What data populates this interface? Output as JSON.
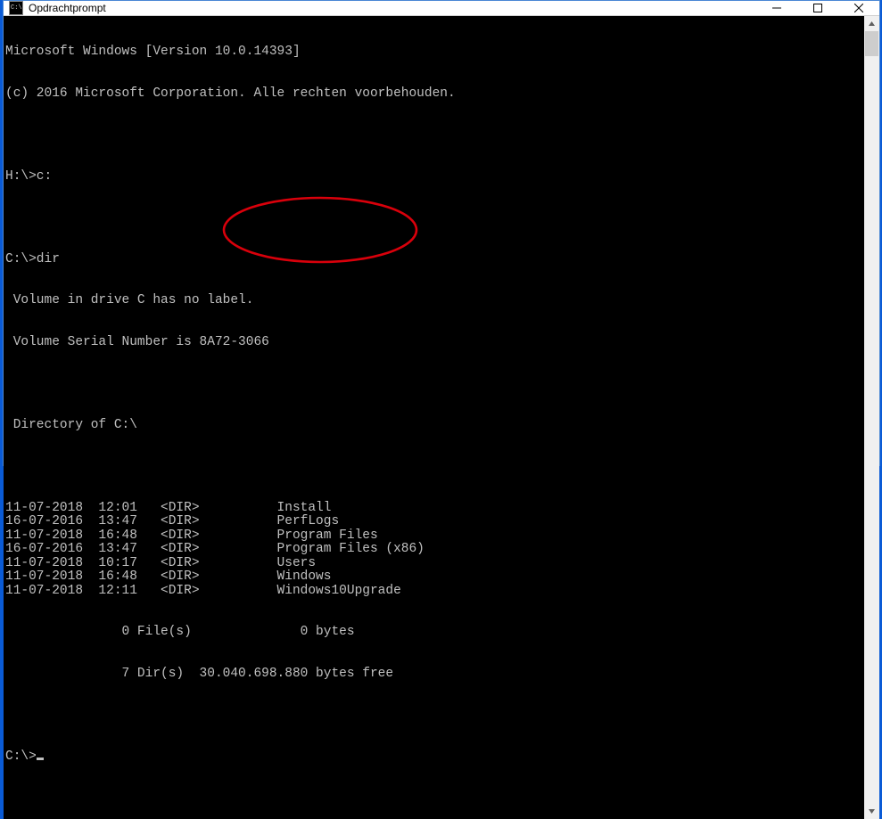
{
  "window": {
    "title": "Opdrachtprompt"
  },
  "terminal": {
    "header1": "Microsoft Windows [Version 10.0.14393]",
    "header2": "(c) 2016 Microsoft Corporation. Alle rechten voorbehouden.",
    "prompt1": "H:\\>c:",
    "prompt2": "C:\\>dir",
    "vol1": " Volume in drive C has no label.",
    "vol2": " Volume Serial Number is 8A72-3066",
    "dirof": " Directory of C:\\",
    "rows": [
      {
        "date": "11-07-2018",
        "time": "12:01",
        "type": "<DIR>",
        "name": "Install"
      },
      {
        "date": "16-07-2016",
        "time": "13:47",
        "type": "<DIR>",
        "name": "PerfLogs"
      },
      {
        "date": "11-07-2018",
        "time": "16:48",
        "type": "<DIR>",
        "name": "Program Files"
      },
      {
        "date": "16-07-2016",
        "time": "13:47",
        "type": "<DIR>",
        "name": "Program Files (x86)"
      },
      {
        "date": "11-07-2018",
        "time": "10:17",
        "type": "<DIR>",
        "name": "Users"
      },
      {
        "date": "11-07-2018",
        "time": "16:48",
        "type": "<DIR>",
        "name": "Windows"
      },
      {
        "date": "11-07-2018",
        "time": "12:11",
        "type": "<DIR>",
        "name": "Windows10Upgrade"
      }
    ],
    "summary1": "               0 File(s)              0 bytes",
    "summary2": "               7 Dir(s)  30.040.698.880 bytes free",
    "prompt3": "C:\\>"
  },
  "annotation": {
    "color": "#d9000b"
  }
}
